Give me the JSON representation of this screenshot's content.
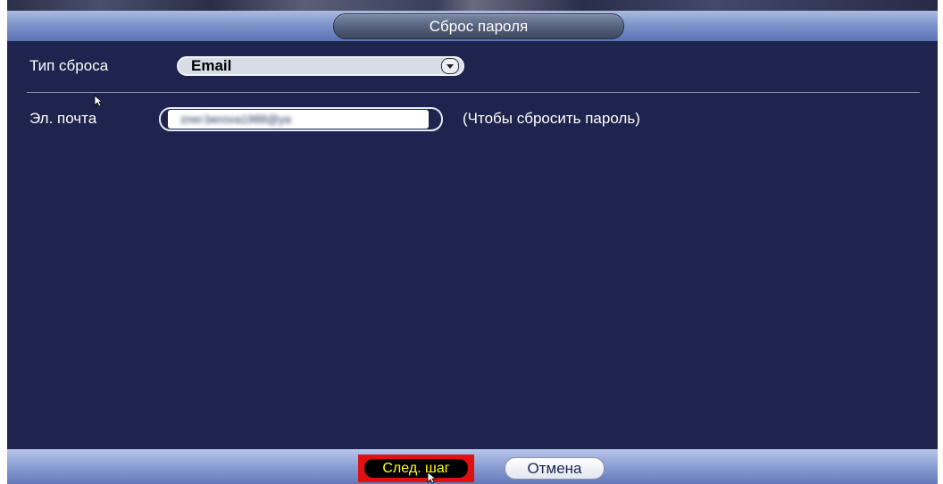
{
  "dialog": {
    "title": "Сброс пароля"
  },
  "form": {
    "reset_type_label": "Тип сброса",
    "reset_type_value": "Email",
    "email_label": "Эл. почта",
    "email_value": "zner.berova1988@ya",
    "email_hint": "(Чтобы сбросить пароль)"
  },
  "footer": {
    "next_label": "След. шаг",
    "cancel_label": "Отмена"
  },
  "icons": {
    "combo_arrow": "chevron-down-icon",
    "cursor": "mouse-pointer-icon"
  },
  "colors": {
    "background": "#1e244d",
    "title_bar": "#7f95cc",
    "highlight": "#e11010",
    "next_text": "#ffff00"
  }
}
